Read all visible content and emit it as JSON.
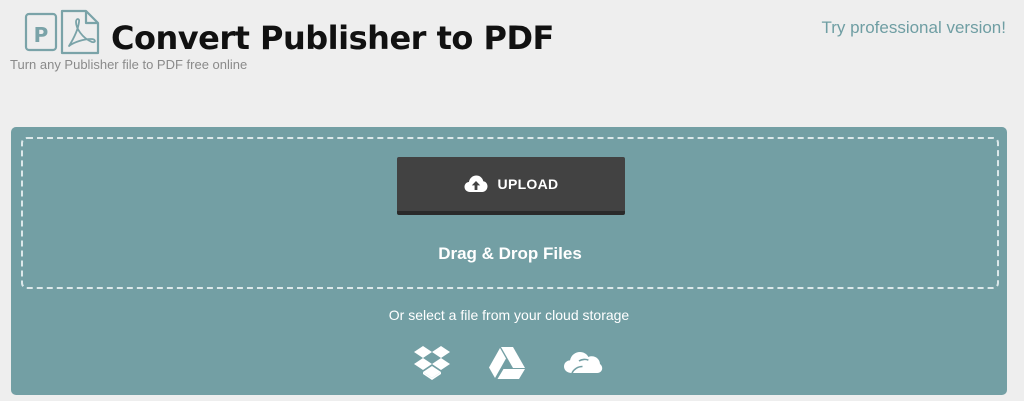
{
  "header": {
    "title": "Convert Publisher to PDF",
    "subtitle": "Turn any Publisher file to PDF free online",
    "pro_link": "Try professional version!",
    "logo_letter": "P"
  },
  "upload": {
    "button_label": "UPLOAD",
    "drag_text": "Drag & Drop Files",
    "cloud_text": "Or select a file from your cloud storage",
    "cloud_providers": [
      "dropbox-icon",
      "google-drive-icon",
      "onedrive-icon"
    ]
  },
  "colors": {
    "background": "#eeeeee",
    "panel": "#739fa4",
    "button": "#424242",
    "link": "#6f9ea3",
    "logo": "#7aa3a8"
  }
}
